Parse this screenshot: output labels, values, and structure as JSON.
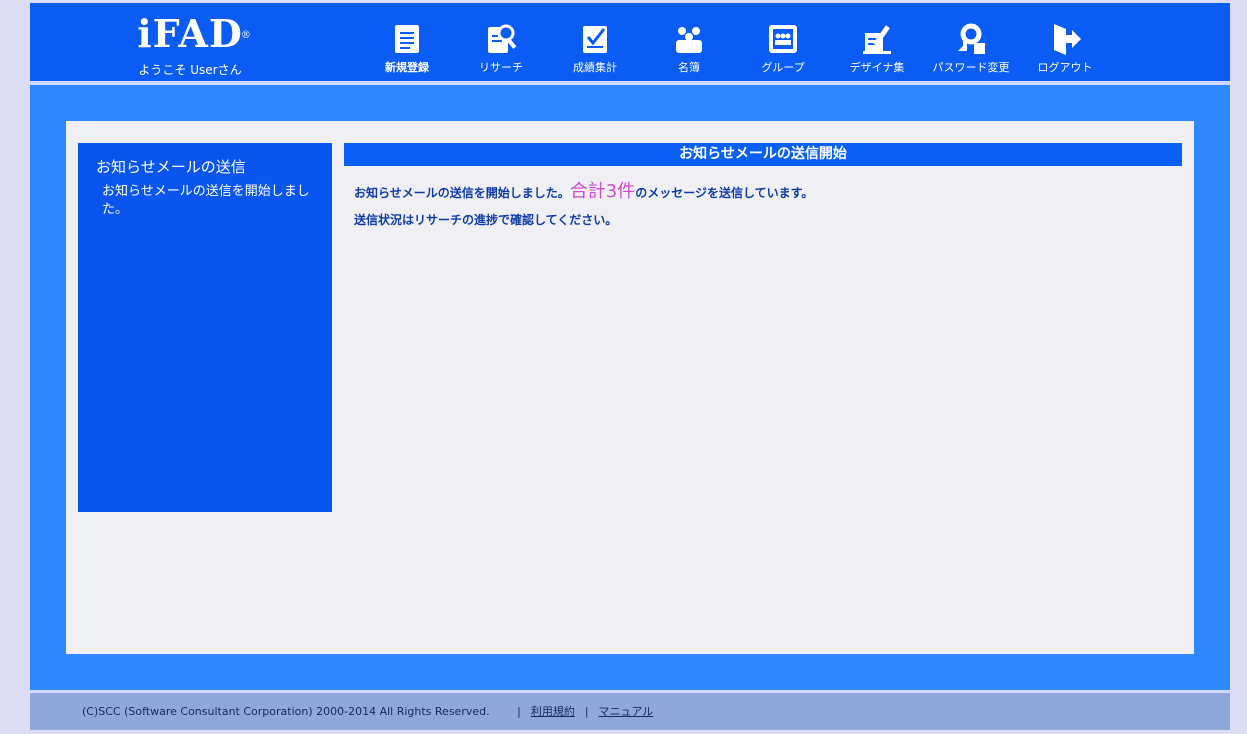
{
  "header": {
    "logo": "iFAD",
    "logo_mark": "®",
    "welcome": "ようこそ Userさん"
  },
  "nav": [
    {
      "label": "新規登録",
      "icon": "new-document-icon"
    },
    {
      "label": "リサーチ",
      "icon": "research-icon"
    },
    {
      "label": "成績集計",
      "icon": "grade-summary-icon"
    },
    {
      "label": "名簿",
      "icon": "roster-icon"
    },
    {
      "label": "グループ",
      "icon": "group-icon"
    },
    {
      "label": "デザイナ集",
      "icon": "designer-icon"
    },
    {
      "label": "パスワード変更",
      "icon": "password-change-icon"
    },
    {
      "label": "ログアウト",
      "icon": "logout-icon"
    }
  ],
  "sidebar": {
    "title": "お知らせメールの送信",
    "text": "お知らせメールの送信を開始しました。"
  },
  "panel": {
    "title": "お知らせメールの送信開始",
    "line1_prefix": "お知らせメールの送信を開始しました。",
    "total": "合計3件",
    "line1_suffix": "のメッセージを送信しています。",
    "line2": "送信状況はリサーチの進捗で確認してください。"
  },
  "footer": {
    "copyright": "(C)SCC (Software Consultant Corporation) 2000-2014 All Rights Reserved.",
    "sep": "|",
    "terms": "利用規約",
    "manual": "マニュアル"
  },
  "colors": {
    "header": "#0a5cf4",
    "main_bg": "#3088ff",
    "sidebar": "#0a55ee",
    "total_accent": "#d04bd0"
  }
}
